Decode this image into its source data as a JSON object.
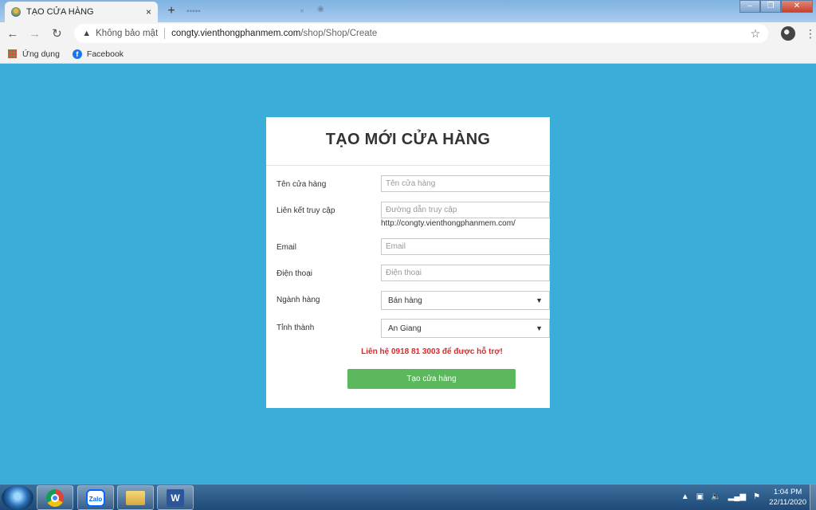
{
  "browser": {
    "tab_title": "TẠO CỬA HÀNG",
    "tab_close": "×",
    "new_tab": "+",
    "security_label": "Không bảo mật",
    "url_host": "congty.vienthongphanmem.com",
    "url_path": "/shop/Shop/Create",
    "bookmarks": [
      {
        "label": "Ứng dụng",
        "icon": "apps-grid-icon"
      },
      {
        "label": "Facebook",
        "icon": "facebook-icon"
      }
    ]
  },
  "form": {
    "title": "TẠO MỚI CỬA HÀNG",
    "fields": {
      "store_name": {
        "label": "Tên cửa hàng",
        "placeholder": "Tên cửa hàng",
        "value": ""
      },
      "access_link": {
        "label": "Liên kết truy cập",
        "placeholder": "Đường dẫn truy cập",
        "value": "",
        "hint": "http://congty.vienthongphanmem.com/"
      },
      "email": {
        "label": "Email",
        "placeholder": "Email",
        "value": ""
      },
      "phone": {
        "label": "Điện thoại",
        "placeholder": "Điện thoại",
        "value": ""
      },
      "industry": {
        "label": "Ngành hàng",
        "selected": "Bán hàng"
      },
      "province": {
        "label": "Tỉnh thành",
        "selected": "An Giang"
      }
    },
    "support_text": "Liên hệ 0918 81 3003 để được hỗ trợ!",
    "submit_label": "Tạo cửa hàng"
  },
  "taskbar": {
    "apps": [
      "chrome",
      "zalo",
      "file-explorer",
      "word"
    ],
    "zalo_label": "Zalo",
    "word_label": "W",
    "time": "1:04 PM",
    "date": "22/11/2020"
  },
  "colors": {
    "page_background": "#3badd9",
    "submit_button": "#5cb85c",
    "support_text": "#e02828"
  }
}
